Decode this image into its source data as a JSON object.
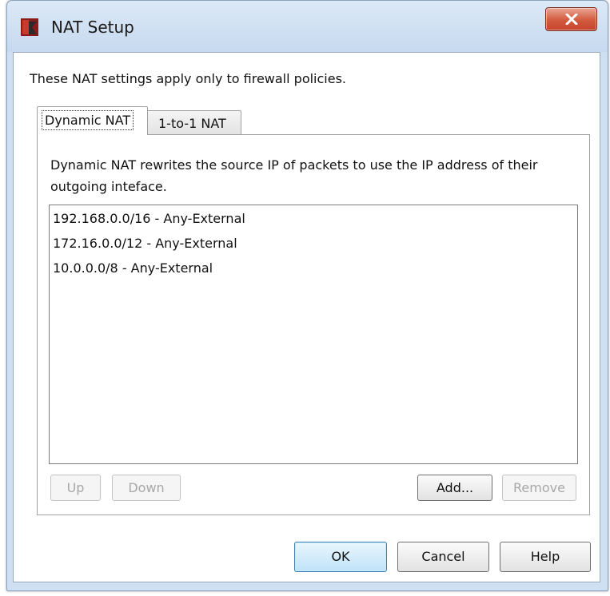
{
  "window": {
    "title": "NAT Setup",
    "icon": "watchguard-app-icon",
    "close_icon": "close-x-icon"
  },
  "intro_text": "These NAT settings apply only to firewall policies.",
  "tabs": [
    {
      "label": "Dynamic NAT",
      "active": true
    },
    {
      "label": "1-to-1 NAT",
      "active": false
    }
  ],
  "panel": {
    "description": "Dynamic NAT rewrites the source IP of packets to use the IP address of their outgoing inteface.",
    "nat_entries": [
      "192.168.0.0/16 - Any-External",
      "172.16.0.0/12 - Any-External",
      "10.0.0.0/8 - Any-External"
    ],
    "buttons": {
      "up": "Up",
      "down": "Down",
      "add": "Add...",
      "remove": "Remove"
    }
  },
  "footer": {
    "ok": "OK",
    "cancel": "Cancel",
    "help": "Help"
  },
  "colors": {
    "frame": "#cfe0f3",
    "close_button": "#d35a3e",
    "default_button": "#bfe3f8"
  }
}
